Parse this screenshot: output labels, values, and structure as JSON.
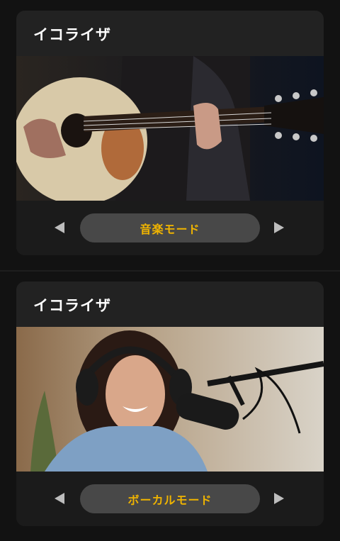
{
  "cards": [
    {
      "title": "イコライザ",
      "mode_label": "音楽モード",
      "image_icon": "guitar-photo"
    },
    {
      "title": "イコライザ",
      "mode_label": "ボーカルモード",
      "image_icon": "podcast-microphone-photo"
    }
  ],
  "colors": {
    "background": "#121212",
    "card": "#222222",
    "pill": "#484848",
    "accent": "#f0b400"
  }
}
